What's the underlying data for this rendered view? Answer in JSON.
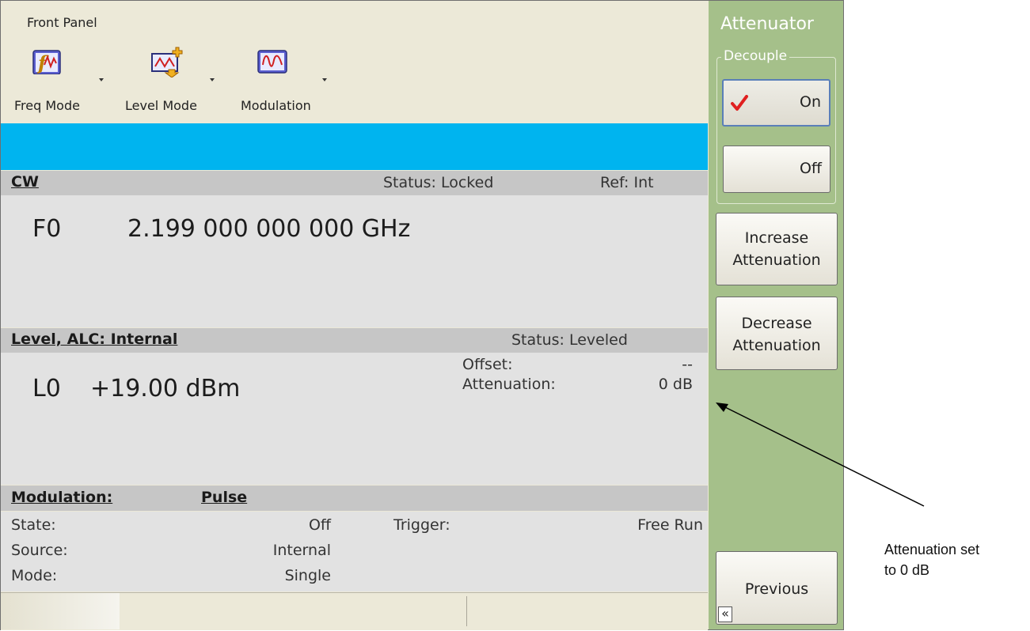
{
  "toolbar": {
    "title": "Front Panel",
    "items": [
      {
        "label": "Freq Mode",
        "icon": "freq-mode-icon"
      },
      {
        "label": "Level Mode",
        "icon": "level-mode-icon"
      },
      {
        "label": "Modulation",
        "icon": "modulation-icon"
      }
    ]
  },
  "cw": {
    "title": "CW",
    "status": "Status: Locked",
    "ref": "Ref: Int",
    "freq_label": "F0",
    "freq_value": "2.199 000 000 000 GHz"
  },
  "level": {
    "title": "Level, ALC: Internal",
    "status": "Status: Leveled",
    "label": "L0",
    "value": "+19.00 dBm",
    "offset_label": "Offset:",
    "offset_value": "--",
    "atten_label": "Attenuation:",
    "atten_value": "0 dB"
  },
  "modulation": {
    "title": "Modulation:",
    "type": "Pulse",
    "state_label": "State:",
    "state_value": "Off",
    "source_label": "Source:",
    "source_value": "Internal",
    "mode_label": "Mode:",
    "mode_value": "Single",
    "trigger_label": "Trigger:",
    "trigger_value": "Free Run"
  },
  "panel": {
    "title": "Attenuator",
    "group_label": "Decouple",
    "on_label": "On",
    "off_label": "Off",
    "increase_line1": "Increase",
    "increase_line2": "Attenuation",
    "decrease_line1": "Decrease",
    "decrease_line2": "Attenuation",
    "previous_label": "Previous",
    "back_glyph": "«"
  },
  "annotation": {
    "line1": "Attenuation set",
    "line2": "to 0 dB"
  },
  "colors": {
    "accent_blue": "#00b4ef",
    "panel_green": "#a5c08a",
    "check_red": "#e02020"
  }
}
